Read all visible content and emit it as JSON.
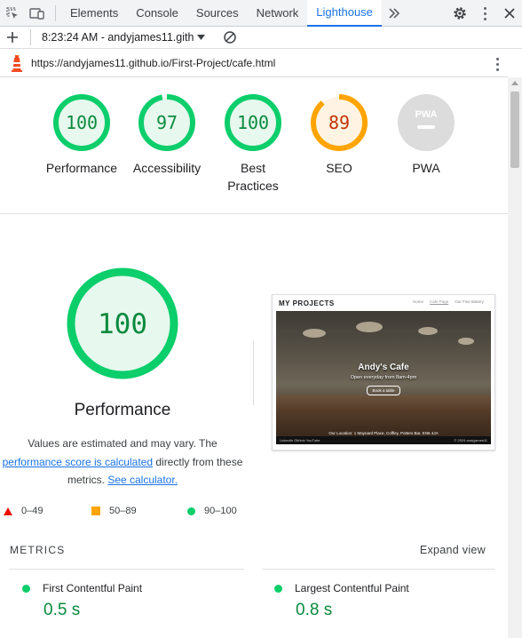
{
  "devtools": {
    "tabs": [
      "Elements",
      "Console",
      "Sources",
      "Network",
      "Lighthouse"
    ],
    "active_tab": "Lighthouse",
    "more_tabs_icon": "chevron-double-right-icon"
  },
  "toolbar": {
    "report_label": "8:23:24 AM - andyjames11.gith"
  },
  "url_bar": {
    "url": "https://andyjames11.github.io/First-Project/cafe.html"
  },
  "gauges": [
    {
      "label": "Performance",
      "score": "100",
      "value": 100,
      "color": "#0cce6b"
    },
    {
      "label": "Accessibility",
      "score": "97",
      "value": 97,
      "color": "#0cce6b"
    },
    {
      "label": "Best\nPractices",
      "score": "100",
      "value": 100,
      "color": "#0cce6b"
    },
    {
      "label": "SEO",
      "score": "89",
      "value": 89,
      "color": "#ffa400"
    },
    {
      "label": "PWA",
      "score": "PWA",
      "value": 0,
      "color": "#cccccc"
    }
  ],
  "performance": {
    "score": "100",
    "title": "Performance",
    "desc_part1": "Values are estimated and may vary. The",
    "link1": "performance score is calculated",
    "desc_part2": " directly from these metrics. ",
    "link2": "See calculator."
  },
  "legend": {
    "fail": "0–49",
    "average": "50–89",
    "pass": "90–100"
  },
  "screenshot": {
    "title": "MY PROJECTS",
    "nav": [
      "Home",
      "Cafe Page",
      "Our Fine Bakery"
    ],
    "hero_title": "Andy's Cafe",
    "hero_sub": "Open everyday from 8am-4pm",
    "button": "Book a table",
    "address": "Our Location: 1 Maynard Place, Coffley, Potters Bar, EN6 4JA",
    "footer_left": "LinkedIn   GitHub   YouTube",
    "footer_right": "© 2024 andyjames11"
  },
  "metrics": {
    "title": "METRICS",
    "expand": "Expand view",
    "items": [
      {
        "label": "First Contentful Paint",
        "value": "0.5 s"
      },
      {
        "label": "Largest Contentful Paint",
        "value": "0.8 s"
      }
    ]
  },
  "colors": {
    "pass": "#0cce6b",
    "average": "#ffa400",
    "fail": "#eb0f00",
    "accent": "#1a73e8"
  }
}
